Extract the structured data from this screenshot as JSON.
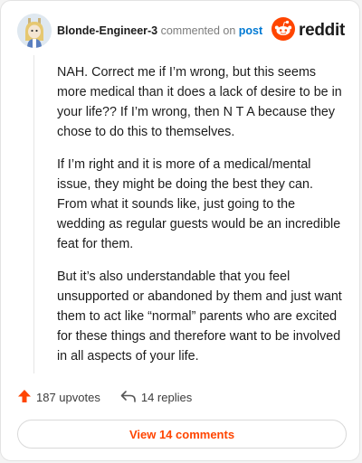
{
  "comment": {
    "username": "Blonde-Engineer-3",
    "action_text": "commented on",
    "post_link": "post",
    "brand_name": "reddit",
    "paragraphs": [
      "NAH. Correct me if I’m wrong, but this seems more medical than it does a lack of desire to be in your life?? If I’m wrong, then N T A because they chose to do this to themselves.",
      "If I’m right and it is more of a medical/mental issue, they might be doing the best they can. From what it sounds like, just going to the wedding as regular guests would be an incredible feat for them.",
      "But it’s also understandable that you feel unsupported or abandoned by them and just want them to act like “normal” parents who are excited for these things and therefore want to be involved in all aspects of your life."
    ],
    "upvotes": "187 upvotes",
    "replies": "14 replies",
    "view_comments": "View 14 comments"
  },
  "colors": {
    "accent": "#ff4500",
    "link": "#0079d3"
  },
  "icons": {
    "upvote": "upvote-arrow-icon",
    "reply": "reply-arrow-icon",
    "brand": "reddit-snoo-icon",
    "avatar": "user-avatar"
  }
}
